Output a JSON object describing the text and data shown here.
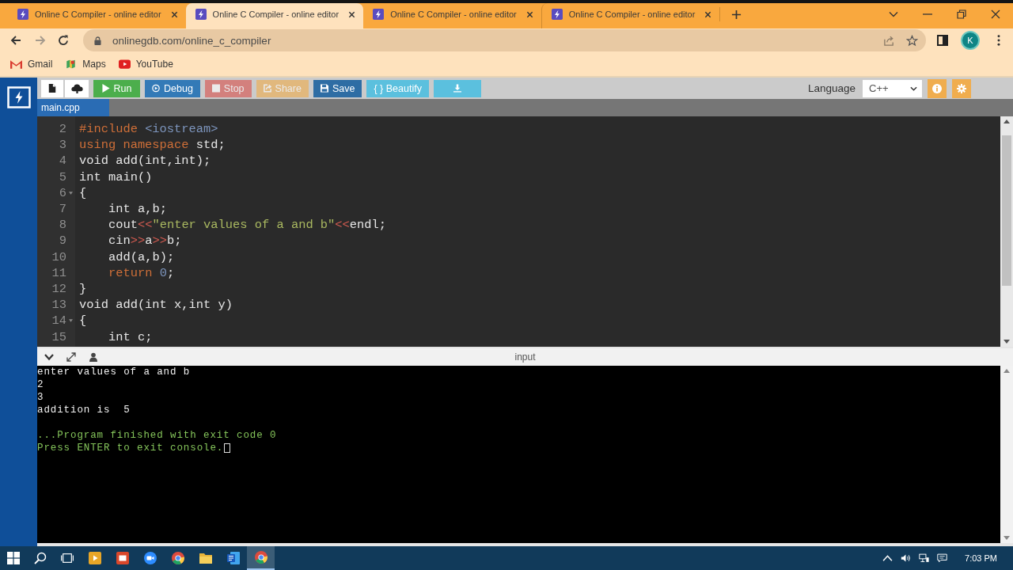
{
  "browser": {
    "tabs": [
      {
        "title": "Online C Compiler - online editor",
        "selected": false
      },
      {
        "title": "Online C Compiler - online editor",
        "selected": true
      },
      {
        "title": "Online C Compiler - online editor",
        "selected": false
      },
      {
        "title": "Online C Compiler - online editor",
        "selected": false
      }
    ],
    "address_bar": {
      "url": "onlinegdb.com/online_c_compiler"
    },
    "profile": {
      "initial": "K"
    },
    "bookmarks": [
      {
        "label": "Gmail",
        "kind": "mail"
      },
      {
        "label": "Maps",
        "kind": "map"
      },
      {
        "label": "YouTube",
        "kind": "video"
      }
    ]
  },
  "toolbar": {
    "buttons": [
      {
        "kind": "new_file",
        "disabled": false
      },
      {
        "kind": "upload",
        "disabled": false
      },
      {
        "kind": "run",
        "label": "Run",
        "disabled": false
      },
      {
        "kind": "debug",
        "label": "Debug",
        "disabled": false
      },
      {
        "kind": "stop",
        "label": "Stop",
        "disabled": true
      },
      {
        "kind": "share",
        "label": "Share",
        "disabled": true
      },
      {
        "kind": "save",
        "label": "Save",
        "disabled": false
      },
      {
        "kind": "beautify",
        "label": "{ } Beautify",
        "disabled": false
      },
      {
        "kind": "download",
        "disabled": false
      }
    ],
    "language": {
      "label": "Language",
      "value": "C++"
    }
  },
  "file_tabs": [
    {
      "name": "main.cpp",
      "selected": true
    }
  ],
  "editor": {
    "lines": [
      {
        "number": "2",
        "tokens": [
          {
            "text": "#include ",
            "kind": "keyword"
          },
          {
            "text": "<iostream>",
            "kind": "header"
          }
        ]
      },
      {
        "number": "3",
        "tokens": [
          {
            "text": "using namespace",
            "kind": "keyword"
          },
          {
            "text": " std;",
            "kind": "plain"
          }
        ]
      },
      {
        "number": "4",
        "tokens": [
          {
            "text": "void add(int,int);",
            "kind": "plain"
          }
        ]
      },
      {
        "number": "5",
        "tokens": [
          {
            "text": "int main()",
            "kind": "plain"
          }
        ]
      },
      {
        "number": "6",
        "tokens": [
          {
            "text": "{",
            "kind": "plain"
          }
        ],
        "children": [
          {
            "number": "7",
            "tokens": [
              {
                "text": "int a,b;",
                "kind": "plain"
              }
            ]
          },
          {
            "number": "8",
            "tokens": [
              {
                "text": "cout",
                "kind": "plain"
              },
              {
                "text": "<<",
                "kind": "operator"
              },
              {
                "text": "\"enter values of a and b\"",
                "kind": "string"
              },
              {
                "text": "<<",
                "kind": "operator"
              },
              {
                "text": "endl;",
                "kind": "plain"
              }
            ]
          },
          {
            "number": "9",
            "tokens": [
              {
                "text": "cin",
                "kind": "plain"
              },
              {
                "text": ">>",
                "kind": "operator"
              },
              {
                "text": "a",
                "kind": "plain"
              },
              {
                "text": ">>",
                "kind": "operator"
              },
              {
                "text": "b;",
                "kind": "plain"
              }
            ]
          },
          {
            "number": "10",
            "tokens": [
              {
                "text": "add(a,b);",
                "kind": "plain"
              }
            ]
          },
          {
            "number": "11",
            "tokens": [
              {
                "text": "return ",
                "kind": "keyword"
              },
              {
                "text": "0",
                "kind": "number"
              },
              {
                "text": ";",
                "kind": "plain"
              }
            ]
          }
        ]
      },
      {
        "number": "12",
        "tokens": [
          {
            "text": "}",
            "kind": "plain"
          }
        ]
      },
      {
        "number": "13",
        "tokens": [
          {
            "text": "void add(int x,int y)",
            "kind": "plain"
          }
        ]
      },
      {
        "number": "14",
        "tokens": [
          {
            "text": "{",
            "kind": "plain"
          }
        ],
        "children": [
          {
            "number": "15",
            "tokens": [
              {
                "text": "int c;",
                "kind": "plain"
              }
            ]
          }
        ]
      }
    ]
  },
  "console": {
    "header": "input",
    "lines": [
      {
        "text": "enter values of a and b",
        "kind": "output"
      },
      {
        "text": "2",
        "kind": "output"
      },
      {
        "text": "3",
        "kind": "output"
      },
      {
        "text": "addition is  5",
        "kind": "output"
      },
      {
        "text": "...Program finished with exit code 0",
        "kind": "status"
      },
      {
        "text": "Press ENTER to exit console.",
        "kind": "status"
      }
    ]
  },
  "taskbar": {
    "apps": [
      {
        "kind": "media",
        "selected": false
      },
      {
        "kind": "slides",
        "selected": false
      },
      {
        "kind": "video_call",
        "selected": false
      },
      {
        "kind": "browser",
        "selected": false
      },
      {
        "kind": "folder",
        "selected": false
      },
      {
        "kind": "word",
        "selected": false
      },
      {
        "kind": "browser",
        "selected": true
      }
    ],
    "clock": "7:03 PM"
  }
}
